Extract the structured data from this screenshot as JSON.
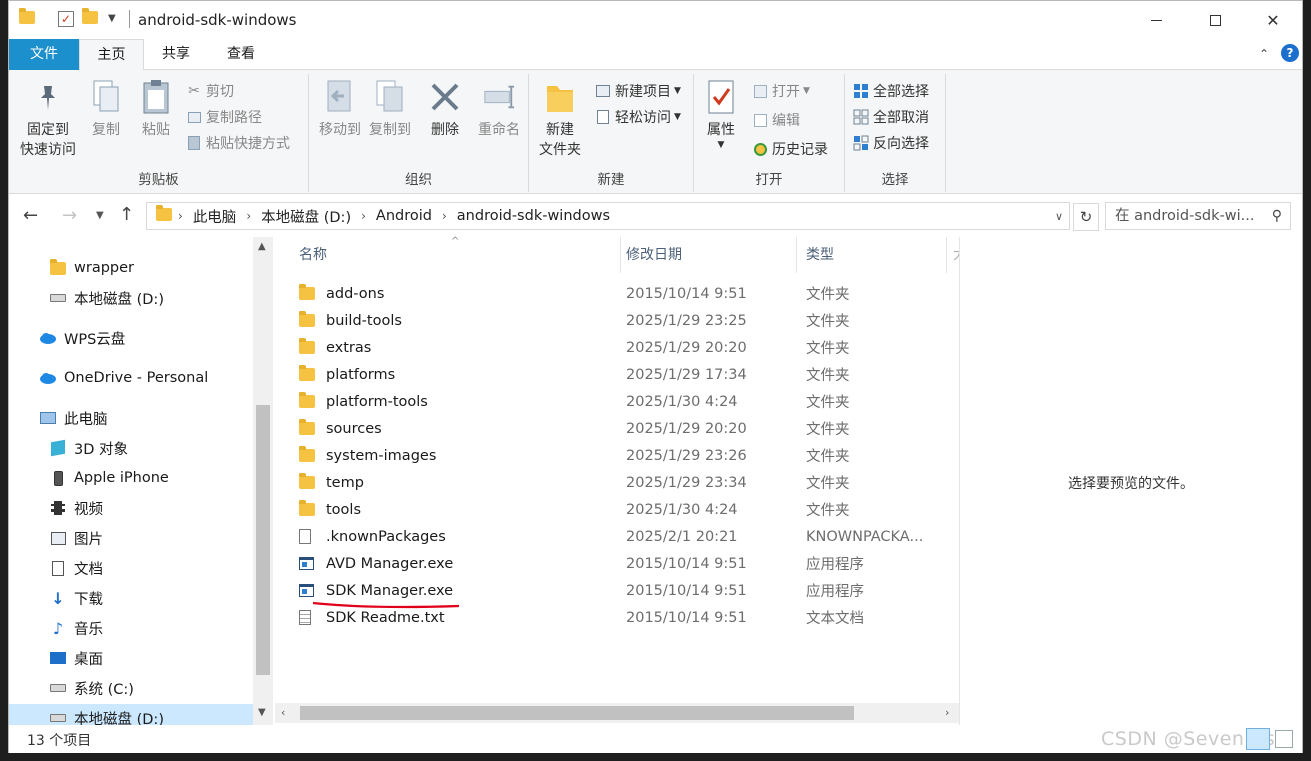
{
  "window": {
    "title": "android-sdk-windows",
    "controls": {
      "minimize": "—",
      "maximize": "☐",
      "close": "✕"
    }
  },
  "tabs": {
    "file": "文件",
    "home": "主页",
    "share": "共享",
    "view": "查看"
  },
  "ribbon": {
    "clipboard": {
      "label": "剪贴板",
      "pin": "固定到\n快速访问",
      "copy": "复制",
      "paste": "粘贴",
      "cut": "剪切",
      "copy_path": "复制路径",
      "paste_shortcut": "粘贴快捷方式"
    },
    "organize": {
      "label": "组织",
      "move_to": "移动到",
      "copy_to": "复制到",
      "delete": "删除",
      "rename": "重命名"
    },
    "new": {
      "label": "新建",
      "new_folder": "新建\n文件夹",
      "new_item": "新建项目",
      "easy_access": "轻松访问"
    },
    "open": {
      "label": "打开",
      "properties": "属性",
      "open": "打开",
      "edit": "编辑",
      "history": "历史记录"
    },
    "select": {
      "label": "选择",
      "select_all": "全部选择",
      "select_none": "全部取消",
      "invert": "反向选择"
    }
  },
  "address": {
    "crumbs": [
      "此电脑",
      "本地磁盘 (D:)",
      "Android",
      "android-sdk-windows"
    ],
    "search_placeholder": "在 android-sdk-wi..."
  },
  "nav": [
    {
      "label": "wrapper",
      "icon": "folder-icon"
    },
    {
      "label": "本地磁盘 (D:)",
      "icon": "drive-icon"
    },
    {
      "label": "WPS云盘",
      "icon": "cloud-icon"
    },
    {
      "label": "OneDrive - Personal",
      "icon": "cloud-icon"
    },
    {
      "label": "此电脑",
      "icon": "computer-icon"
    },
    {
      "label": "3D 对象",
      "icon": "cube-icon"
    },
    {
      "label": "Apple iPhone",
      "icon": "phone-icon"
    },
    {
      "label": "视频",
      "icon": "video-icon"
    },
    {
      "label": "图片",
      "icon": "picture-icon"
    },
    {
      "label": "文档",
      "icon": "document-icon"
    },
    {
      "label": "下载",
      "icon": "download-icon"
    },
    {
      "label": "音乐",
      "icon": "music-icon"
    },
    {
      "label": "桌面",
      "icon": "desktop-icon"
    },
    {
      "label": "系统 (C:)",
      "icon": "drive-icon"
    },
    {
      "label": "本地磁盘 (D:)",
      "icon": "drive-icon"
    }
  ],
  "columns": {
    "name": "名称",
    "date": "修改日期",
    "type": "类型",
    "size": "大"
  },
  "files": [
    {
      "name": "add-ons",
      "date": "2015/10/14 9:51",
      "type": "文件夹",
      "icon": "folder-icon"
    },
    {
      "name": "build-tools",
      "date": "2025/1/29 23:25",
      "type": "文件夹",
      "icon": "folder-icon"
    },
    {
      "name": "extras",
      "date": "2025/1/29 20:20",
      "type": "文件夹",
      "icon": "folder-icon"
    },
    {
      "name": "platforms",
      "date": "2025/1/29 17:34",
      "type": "文件夹",
      "icon": "folder-icon"
    },
    {
      "name": "platform-tools",
      "date": "2025/1/30 4:24",
      "type": "文件夹",
      "icon": "folder-icon"
    },
    {
      "name": "sources",
      "date": "2025/1/29 20:20",
      "type": "文件夹",
      "icon": "folder-icon"
    },
    {
      "name": "system-images",
      "date": "2025/1/29 23:26",
      "type": "文件夹",
      "icon": "folder-icon"
    },
    {
      "name": "temp",
      "date": "2025/1/29 23:34",
      "type": "文件夹",
      "icon": "folder-icon"
    },
    {
      "name": "tools",
      "date": "2025/1/30 4:24",
      "type": "文件夹",
      "icon": "folder-icon"
    },
    {
      "name": ".knownPackages",
      "date": "2025/2/1 20:21",
      "type": "KNOWNPACKA...",
      "icon": "file-icon"
    },
    {
      "name": "AVD Manager.exe",
      "date": "2015/10/14 9:51",
      "type": "应用程序",
      "icon": "exe-icon"
    },
    {
      "name": "SDK Manager.exe",
      "date": "2015/10/14 9:51",
      "type": "应用程序",
      "icon": "exe-icon"
    },
    {
      "name": "SDK Readme.txt",
      "date": "2015/10/14 9:51",
      "type": "文本文档",
      "icon": "text-file-icon"
    }
  ],
  "preview_text": "选择要预览的文件。",
  "status": {
    "count": "13 个项目"
  },
  "watermark": "CSDN @Seven.lts",
  "colors": {
    "file_tab": "#1c8fcd",
    "folder": "#f5c242",
    "selection": "#cce8ff",
    "underline": "#e0001a"
  }
}
